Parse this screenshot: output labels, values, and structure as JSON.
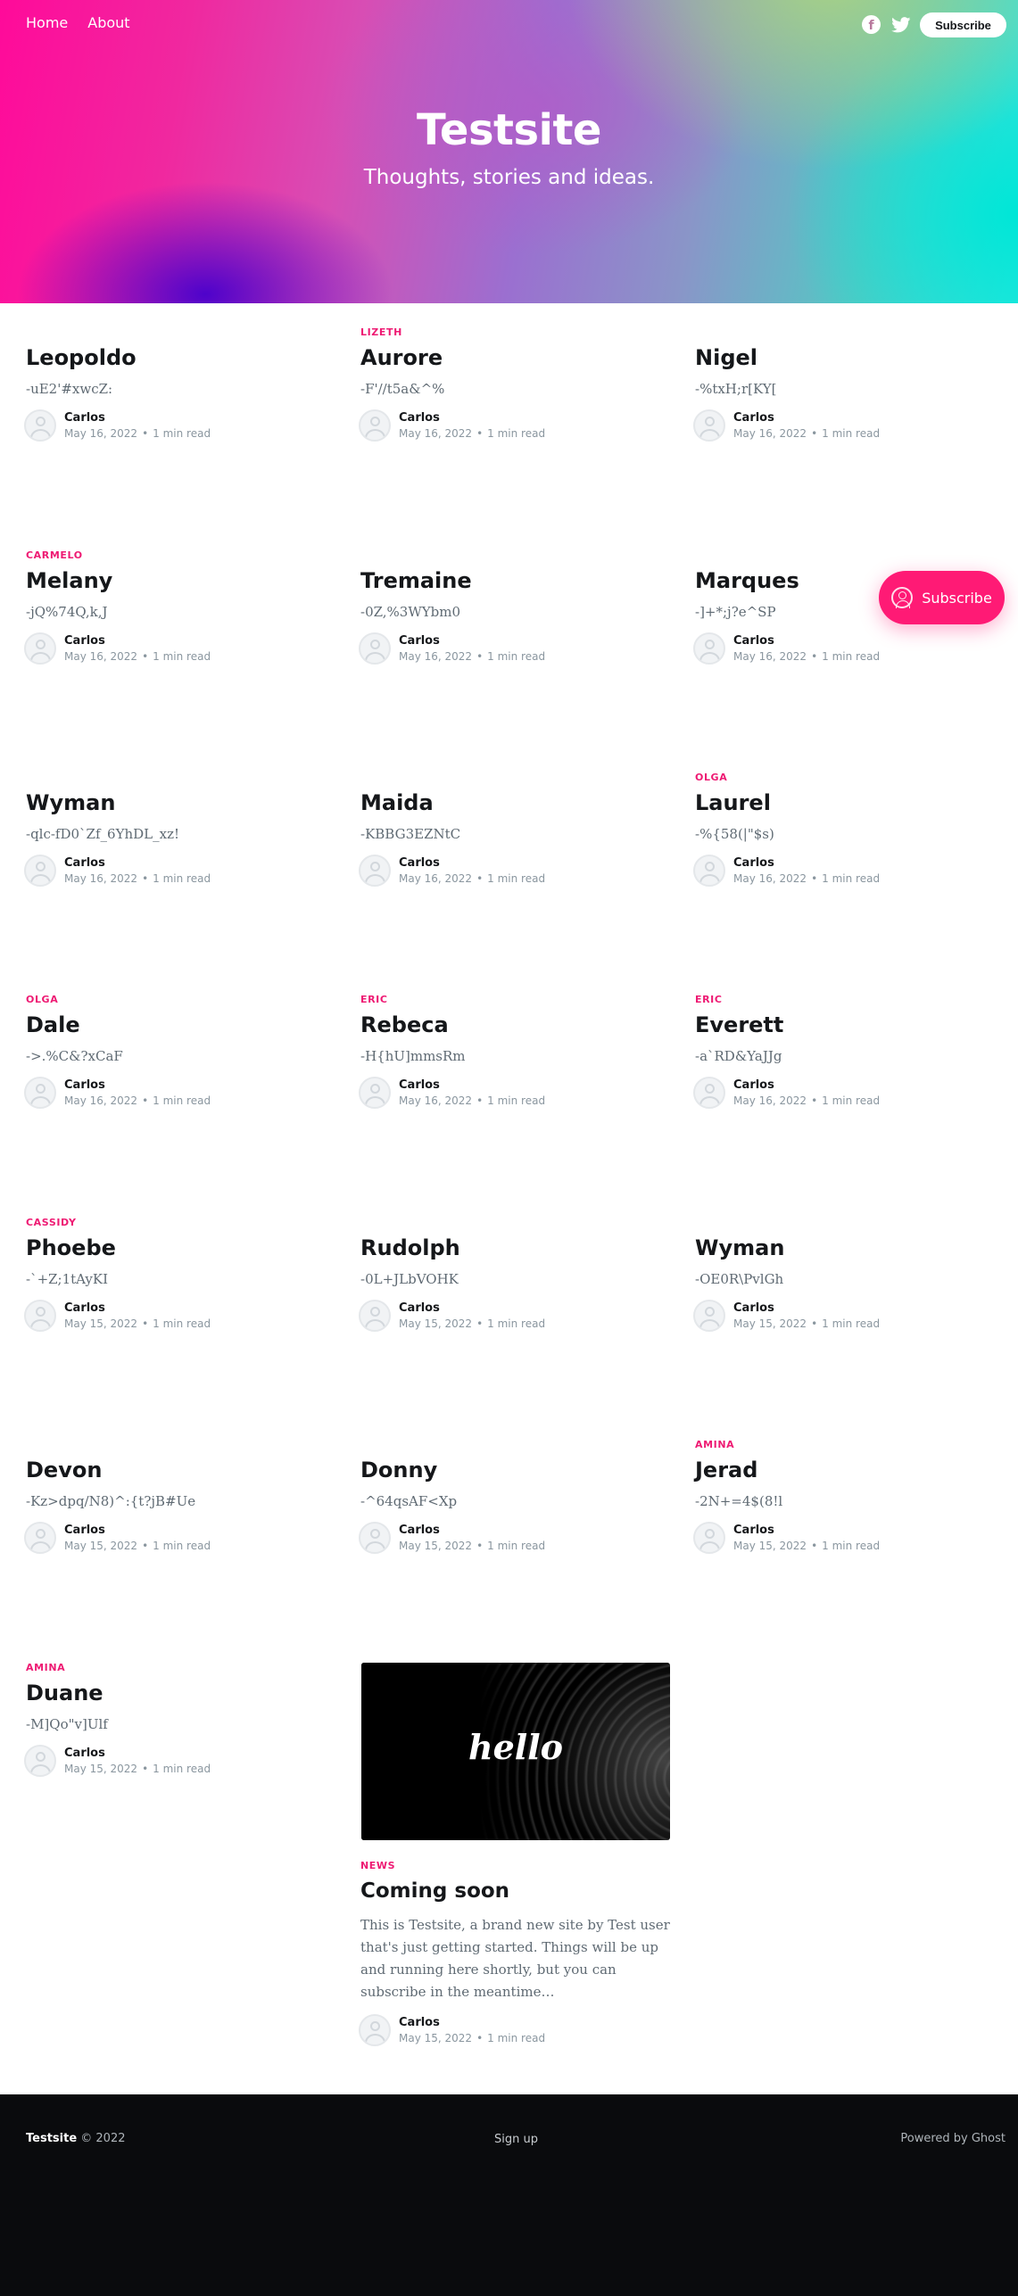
{
  "header": {
    "nav": [
      "Home",
      "About"
    ],
    "subscribe_label": "Subscribe",
    "site_title": "Testsite",
    "site_description": "Thoughts, stories and ideas."
  },
  "colors": {
    "accent": "#ee1a73",
    "footer_bg": "#0a0b0d"
  },
  "icons": [
    "facebook-icon",
    "twitter-icon",
    "avatar-icon",
    "user-icon"
  ],
  "posts": [
    {
      "tag": "",
      "title": "Leopoldo",
      "excerpt": "-uE2'#xwcZ:",
      "author": "Carlos",
      "date": "May 16, 2022",
      "read": "1 min read"
    },
    {
      "tag": "LIZETH",
      "title": "Aurore",
      "excerpt": "-F'//t5a&^%",
      "author": "Carlos",
      "date": "May 16, 2022",
      "read": "1 min read"
    },
    {
      "tag": "",
      "title": "Nigel",
      "excerpt": "-%txH;r[KY[",
      "author": "Carlos",
      "date": "May 16, 2022",
      "read": "1 min read"
    },
    {
      "tag": "CARMELO",
      "title": "Melany",
      "excerpt": "-jQ%74Q,k,J",
      "author": "Carlos",
      "date": "May 16, 2022",
      "read": "1 min read"
    },
    {
      "tag": "",
      "title": "Tremaine",
      "excerpt": "-0Z,%3WYbm0",
      "author": "Carlos",
      "date": "May 16, 2022",
      "read": "1 min read"
    },
    {
      "tag": "",
      "title": "Marques",
      "excerpt": "-]+*;j?e^SP",
      "author": "Carlos",
      "date": "May 16, 2022",
      "read": "1 min read"
    },
    {
      "tag": "",
      "title": "Wyman",
      "excerpt": "-qlc-fD0`Zf_6YhDL_xz!",
      "author": "Carlos",
      "date": "May 16, 2022",
      "read": "1 min read"
    },
    {
      "tag": "",
      "title": "Maida",
      "excerpt": "-KBBG3EZNtC",
      "author": "Carlos",
      "date": "May 16, 2022",
      "read": "1 min read"
    },
    {
      "tag": "OLGA",
      "title": "Laurel",
      "excerpt": "-%{58(|\"$s)",
      "author": "Carlos",
      "date": "May 16, 2022",
      "read": "1 min read"
    },
    {
      "tag": "OLGA",
      "title": "Dale",
      "excerpt": "->.%C&?xCaF",
      "author": "Carlos",
      "date": "May 16, 2022",
      "read": "1 min read"
    },
    {
      "tag": "ERIC",
      "title": "Rebeca",
      "excerpt": "-H{hU]mmsRm",
      "author": "Carlos",
      "date": "May 16, 2022",
      "read": "1 min read"
    },
    {
      "tag": "ERIC",
      "title": "Everett",
      "excerpt": "-a`RD&YaJJg",
      "author": "Carlos",
      "date": "May 16, 2022",
      "read": "1 min read"
    },
    {
      "tag": "CASSIDY",
      "title": "Phoebe",
      "excerpt": "-`+Z;1tAyKI",
      "author": "Carlos",
      "date": "May 15, 2022",
      "read": "1 min read"
    },
    {
      "tag": "",
      "title": "Rudolph",
      "excerpt": "-0L+JLbVOHK",
      "author": "Carlos",
      "date": "May 15, 2022",
      "read": "1 min read"
    },
    {
      "tag": "",
      "title": "Wyman",
      "excerpt": "-OE0R\\PvlGh",
      "author": "Carlos",
      "date": "May 15, 2022",
      "read": "1 min read"
    },
    {
      "tag": "",
      "title": "Devon",
      "excerpt": "-Kz>dpq/N8)^:{t?jB#Ue",
      "author": "Carlos",
      "date": "May 15, 2022",
      "read": "1 min read"
    },
    {
      "tag": "",
      "title": "Donny",
      "excerpt": "-^64qsAF<Xp",
      "author": "Carlos",
      "date": "May 15, 2022",
      "read": "1 min read"
    },
    {
      "tag": "AMINA",
      "title": "Jerad",
      "excerpt": "-2N+=4$(8!l",
      "author": "Carlos",
      "date": "May 15, 2022",
      "read": "1 min read"
    },
    {
      "tag": "AMINA",
      "title": "Duane",
      "excerpt": "-M]Qo\"v]Ulf",
      "author": "Carlos",
      "date": "May 15, 2022",
      "read": "1 min read"
    }
  ],
  "feature": {
    "image_text": "hello",
    "tag": "NEWS",
    "title": "Coming soon",
    "excerpt": "This is Testsite, a brand new site by Test user that's just getting started. Things will be up and running here shortly, but you can subscribe in the meantime…",
    "author": "Carlos",
    "date": "May 15, 2022",
    "read": "1 min read"
  },
  "floating_subscribe": {
    "label": "Subscribe"
  },
  "footer": {
    "site_name": "Testsite",
    "copyright": "© 2022",
    "signup": "Sign up",
    "powered": "Powered by Ghost"
  }
}
